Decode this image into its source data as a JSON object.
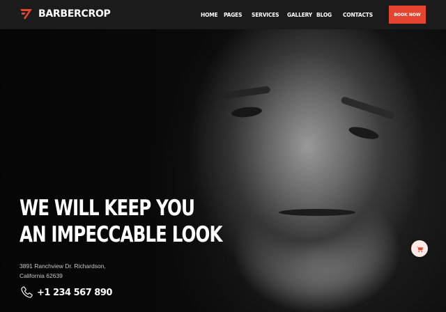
{
  "brand": {
    "name": "BARBERCROP",
    "accent": "#e5442f"
  },
  "nav": {
    "items": [
      {
        "label": "HOME"
      },
      {
        "label": "PAGES"
      },
      {
        "label": "SERVICES"
      },
      {
        "label": "GALLERY"
      },
      {
        "label": "BLOG"
      },
      {
        "label": "CONTACTS"
      }
    ],
    "cta_label": "BOOK NOW"
  },
  "hero": {
    "headline_line1": "WE WILL KEEP YOU",
    "headline_line2": "AN IMPECCABLE LOOK",
    "address_line1": "3891 Ranchview Dr. Richardson,",
    "address_line2": "California 62639",
    "phone": "+1 234 567 890",
    "phone_icon": "phone-icon"
  },
  "fab": {
    "icon": "cart-icon"
  }
}
